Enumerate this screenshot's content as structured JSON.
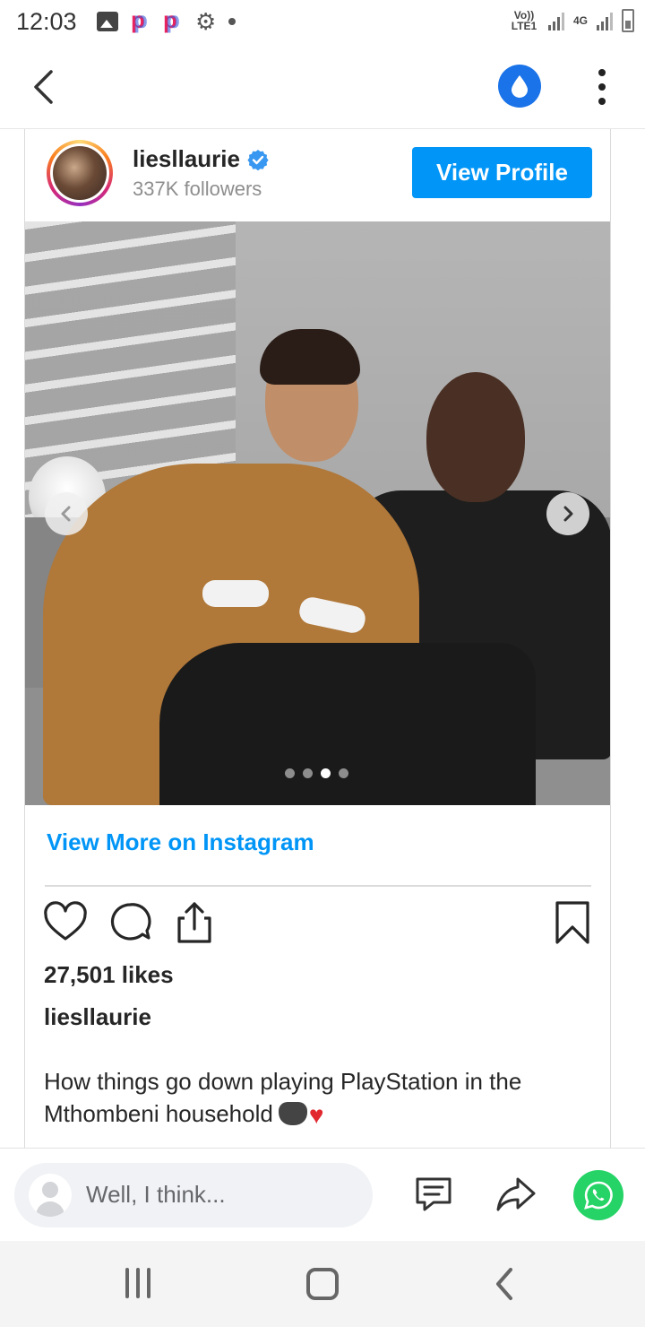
{
  "status_bar": {
    "time": "12:03",
    "network_left": "Vo)) LTE1",
    "network_right": "4G",
    "icons": [
      "gallery-icon",
      "p-app-icon",
      "p-app-icon",
      "gear-icon",
      "notification-dot",
      "signal-icon",
      "battery-icon"
    ]
  },
  "header": {
    "back_icon": "chevron-left-icon",
    "drop_icon": "water-drop-icon",
    "menu_icon": "more-vertical-icon",
    "accent_color": "#1a73e8"
  },
  "post": {
    "username": "liesllaurie",
    "verified": true,
    "followers": "337K followers",
    "view_profile_label": "View Profile",
    "carousel": {
      "slide_count": 4,
      "active_index": 2
    },
    "view_more_label": "View More on Instagram",
    "likes": "27,501 likes",
    "author": "liesllaurie",
    "caption": "How things go down playing PlayStation in the Mthombeni household",
    "caption_emojis": [
      "game-controller-emoji",
      "red-heart-emoji"
    ],
    "link_color": "#0095f6"
  },
  "comment_bar": {
    "placeholder": "Well, I think...",
    "icons": [
      "comment-icon",
      "share-icon",
      "whatsapp-icon"
    ]
  },
  "system_nav": {
    "buttons": [
      "recent-apps",
      "home",
      "back"
    ]
  }
}
